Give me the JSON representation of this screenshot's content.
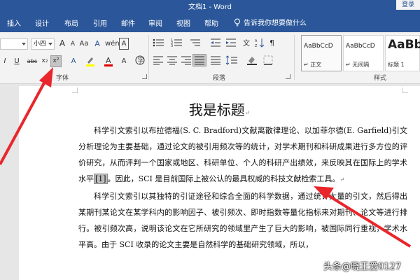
{
  "titlebar": {
    "title": "文档1 - Word",
    "signin": "登录"
  },
  "tabs": [
    "插入",
    "设计",
    "布局",
    "引用",
    "邮件",
    "审阅",
    "视图",
    "帮助"
  ],
  "tellme": "告诉我你想要做什么",
  "ribbon": {
    "font_size": "小四",
    "superscript": "x²",
    "subscript": "x₂",
    "strikethrough": "abc",
    "font_group_label": "字体",
    "paragraph_group_label": "段落",
    "styles_group_label": "样式",
    "styles": [
      {
        "sample": "AaBbCcD",
        "name": "正文"
      },
      {
        "sample": "AaBbCcD",
        "name": "无间隔"
      },
      {
        "sample": "AaBb",
        "name": "标题 1"
      }
    ]
  },
  "document": {
    "title": "我是标题",
    "p1_before": "科学引文索引以布拉德福(S. C. Bradford)文献离散律理论、以加菲尔德(E. Garfield)引文分析理论为主要基础，通过论文的被引用频次等的统计，对学术期刊和科研成果进行多方位的评价研究，从而评判一个国家或地区、科研单位、个人的科研产出绩效，来反映其在国际上的学术水平",
    "p1_cite": "[1]",
    "p1_after": "。因此，SCI 是目前国际上被公认的最具权威的科技文献检索工具。",
    "p2": "科学引文索引以其独特的引证途径和综合全面的科学数据，通过统计大量的引文，然后得出某期刊某论文在某学科内的影响因子、被引频次、即时指数等量化指标来对期刊、论文等进行排行。被引频次高，说明该论文在它所研究的领域里产生了巨大的影响，被国际同行重视，学术水平高。由于 SCI 收录的论文主要是自然科学的基础研究领域，所以，"
  },
  "watermark": "头条@晓王爱0127",
  "colors": {
    "accent": "#2b579a",
    "highlight": "#ffff00",
    "font_color": "#e00000",
    "arrow": "#e8262b"
  }
}
